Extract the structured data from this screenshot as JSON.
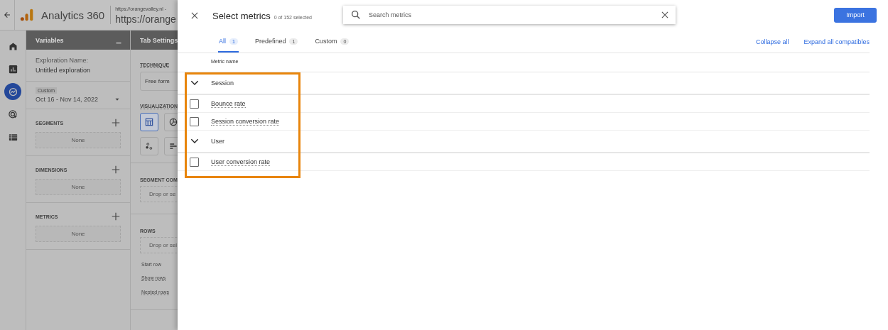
{
  "app": {
    "product": "Analytics 360",
    "url_small": "https://orangevalley.nl -",
    "url_large": "https://orange"
  },
  "nav_rail": [
    {
      "kind": "home",
      "selected": false
    },
    {
      "kind": "reports",
      "selected": false
    },
    {
      "kind": "explore",
      "selected": true
    },
    {
      "kind": "advertising",
      "selected": false
    },
    {
      "kind": "configure",
      "selected": false
    }
  ],
  "variables_panel": {
    "title": "Variables",
    "exploration_label": "Exploration Name:",
    "exploration_name": "Untitled exploration",
    "date_badge": "Custom",
    "date_range": "Oct 16 - Nov 14, 2022",
    "sections": [
      {
        "title": "SEGMENTS",
        "placeholder": "None"
      },
      {
        "title": "DIMENSIONS",
        "placeholder": "None"
      },
      {
        "title": "METRICS",
        "placeholder": "None"
      }
    ]
  },
  "tab_settings": {
    "title": "Tab Settings",
    "technique_label": "TECHNIQUE",
    "technique_value": "Free form",
    "visualization_label": "VISUALIZATION",
    "visualizations": [
      {
        "kind": "table",
        "selected": true
      },
      {
        "kind": "donut",
        "selected": false
      },
      {
        "kind": "scatter",
        "selected": false
      },
      {
        "kind": "bars",
        "selected": false
      }
    ],
    "segment_label": "SEGMENT COM",
    "segment_drop": "Drop or se",
    "rows_label": "ROWS",
    "rows_drop": "Drop or sel",
    "row_options": [
      "Start row",
      "Show rows",
      "Nested rows"
    ]
  },
  "dialog": {
    "title": "Select metrics",
    "selected_count": "0 of 152 selected",
    "search": {
      "placeholder": "Search metrics"
    },
    "import_button": "Import",
    "tabs": [
      {
        "label": "All",
        "count": "1",
        "selected": true
      },
      {
        "label": "Predefined",
        "count": "1",
        "selected": false
      },
      {
        "label": "Custom",
        "count": "0",
        "selected": false
      }
    ],
    "collapse_all": "Collapse all",
    "expand_all": "Expand all compatibles",
    "column_header": "Metric name",
    "groups": [
      {
        "name": "Session",
        "expanded": true,
        "children": [
          {
            "name": "Bounce rate",
            "checked": false
          },
          {
            "name": "Session conversion rate",
            "checked": false
          }
        ]
      },
      {
        "name": "User",
        "expanded": true,
        "children": [
          {
            "name": "User conversion rate",
            "checked": false
          }
        ]
      }
    ]
  }
}
